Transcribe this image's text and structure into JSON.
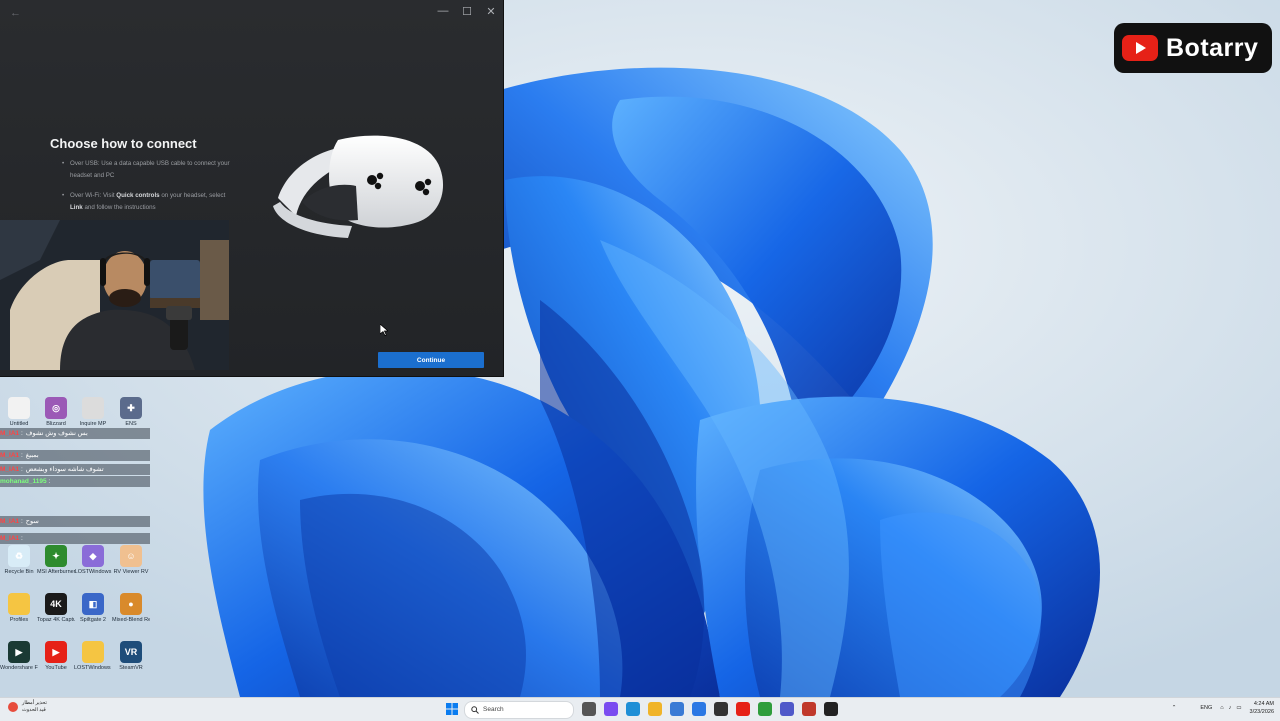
{
  "window": {
    "back_glyph": "←",
    "controls": {
      "minimize": "—",
      "maximize": "☐",
      "close": "✕"
    },
    "title": "Choose how to connect",
    "options": [
      {
        "lead": "Over USB: Use a data capable USB cable to connect your headset and PC"
      },
      {
        "lead": "Over Wi-Fi: Visit ",
        "bold": "Quick controls",
        "mid": " on your headset, select ",
        "bold2": "Link",
        "tail": " and follow the instructions"
      }
    ],
    "continue_label": "Continue"
  },
  "logo": {
    "name": "Botarry",
    "colors": {
      "bg": "#111111",
      "red": "#e62117"
    }
  },
  "desktop_icons": [
    {
      "label": "Untitled",
      "color": "#f2f2f2",
      "glyph": ""
    },
    {
      "label": "Blizzard",
      "color": "#9b59b6",
      "glyph": "◎"
    },
    {
      "label": "Inquire MP",
      "color": "#dcdcdc",
      "glyph": ""
    },
    {
      "label": "ENS",
      "color": "#5b6b8c",
      "glyph": "✚"
    },
    {
      "label": "Recycle Bin",
      "color": "#d8ecf7",
      "glyph": "♻"
    },
    {
      "label": "MSI Afterburner",
      "color": "#2e8b2e",
      "glyph": "✦"
    },
    {
      "label": "LOSTWindows",
      "color": "#8a6cd8",
      "glyph": "◆"
    },
    {
      "label": "RV Viewer RV",
      "color": "#f0c090",
      "glyph": "☺"
    },
    {
      "label": "Profiles",
      "color": "#f5c542",
      "glyph": ""
    },
    {
      "label": "Topaz 4K Capture",
      "color": "#1a1a1a",
      "glyph": "4K"
    },
    {
      "label": "Spiltgate 2",
      "color": "#3a67c8",
      "glyph": "◧"
    },
    {
      "label": "Mixed-Blend Restaurant",
      "color": "#d98a2b",
      "glyph": "●"
    },
    {
      "label": "Wondershare Filmora 13",
      "color": "#1a3a34",
      "glyph": "▶"
    },
    {
      "label": "YouTube",
      "color": "#e62117",
      "glyph": "▶"
    },
    {
      "label": "LOSTWindows - Copy",
      "color": "#f5c542",
      "glyph": ""
    },
    {
      "label": "SteamVR",
      "color": "#1e4d7a",
      "glyph": "VR"
    }
  ],
  "chat": [
    {
      "user": "M_IA1",
      "text": "بس نشوف وش نشوف"
    },
    {
      "user": "M_IA1",
      "text": "بمبيغ"
    },
    {
      "user": "M_IA1",
      "text": "تشوف شاشه سوداء وبشعض"
    },
    {
      "user": "mohanad_1195",
      "text": ""
    },
    {
      "user": "M_IA1",
      "text": "سوح"
    },
    {
      "user": "M_IA1",
      "text": ""
    }
  ],
  "taskbar": {
    "weather": {
      "line1": "تحذير أمطار",
      "line2": "قيد الحدوث"
    },
    "search_placeholder": "Search",
    "tray": {
      "lang": "ENG",
      "time": "4:24 AM",
      "date": "3/23/2026"
    }
  }
}
